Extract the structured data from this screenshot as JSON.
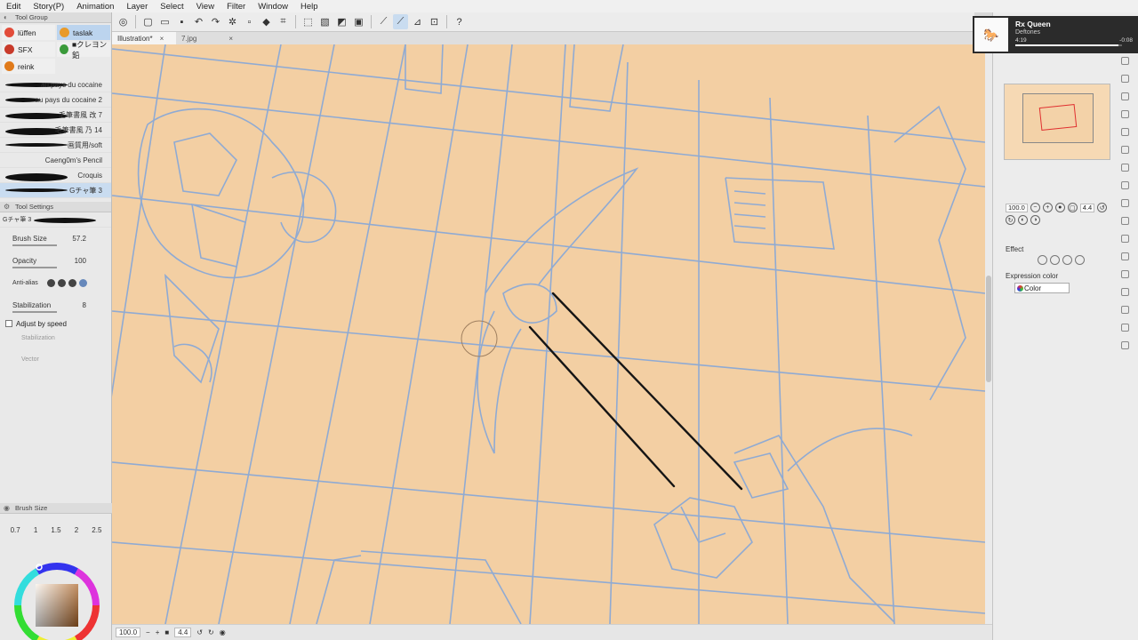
{
  "menu": [
    "Edit",
    "Story(P)",
    "Animation",
    "Layer",
    "Select",
    "View",
    "Filter",
    "Window",
    "Help"
  ],
  "tabs": [
    {
      "label": "Illustration*",
      "close": "×"
    },
    {
      "label": "7.jpg",
      "close": "×"
    }
  ],
  "tool_group": {
    "title": "Tool Group",
    "groups": [
      {
        "label": "lüffen",
        "color": "#e24c3a"
      },
      {
        "label": "taslak",
        "color": "#e89a2a"
      },
      {
        "label": "SFX",
        "color": "#c83a2a"
      },
      {
        "label": "■クレヨン鉛",
        "color": "#3a9a3a"
      },
      {
        "label": "reink",
        "color": "#e07a1a"
      }
    ]
  },
  "brushes": [
    {
      "label": "au pays du cocaine"
    },
    {
      "label": "au pays du cocaine 2"
    },
    {
      "label": "毛筆書風 改 7"
    },
    {
      "label": "毛筆書風 乃 14"
    },
    {
      "label": "画質用/soft"
    },
    {
      "label": "Caeng0m's Pencil"
    },
    {
      "label": "Croquis"
    },
    {
      "label": "Gチャ筆 3"
    }
  ],
  "tool_settings": {
    "title": "Tool Settings",
    "brush_name": "Gチャ筆 3",
    "brush_size_label": "Brush Size",
    "brush_size_value": "57.2",
    "opacity_label": "Opacity",
    "opacity_value": "100",
    "antialias_label": "Anti-alias",
    "stabilization_label": "Stabilization",
    "stabilization_value": "8",
    "adjust_speed_label": "Adjust by speed",
    "stab_speed_label": "Stabilization",
    "vector_label": "Vector"
  },
  "brush_size_panel": {
    "title": "Brush Size",
    "sizes": [
      "0.7",
      "1",
      "1.5",
      "2",
      "2.5"
    ]
  },
  "status": {
    "zoom": "100.0",
    "angle": "4.4"
  },
  "navigator": {
    "zoom": "100.0",
    "angle": "4.4"
  },
  "effect": {
    "title": "Effect",
    "expression_label": "Expression color",
    "expression_value": "Color"
  },
  "music": {
    "title": "Rx Queen",
    "artist": "Deftones",
    "elapsed": "4:19",
    "remaining": "-0:08",
    "progress": 0.97
  },
  "colors": {
    "canvas": "#f3cfa3",
    "sketch": "#8aa9d6",
    "ink": "#151515",
    "accent": "#c9dcf0"
  }
}
